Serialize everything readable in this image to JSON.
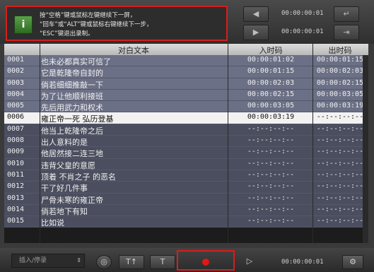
{
  "hint": {
    "icon_text": "i",
    "lines": [
      "按“空格”键或鼠标左键继续下一屏，",
      "“回车”或“ALT”键或鼠标右键继续下一步，",
      "“ESC”键退出录制。"
    ]
  },
  "top_controls": {
    "time_upper": "00:00:00:01",
    "time_lower": "00:00:00:01",
    "prev_icon": "step-back-icon",
    "next_icon": "step-forward-icon",
    "enter_icon": "enter-icon",
    "exit_icon": "exit-icon"
  },
  "table": {
    "headers": {
      "text": "对白文本",
      "in": "入时码",
      "out": "出时码"
    },
    "rows": [
      {
        "idx": "0001",
        "text": "也未必都真实可信了",
        "in": "00:00:01:02",
        "out": "00:00:01:15",
        "state": "done"
      },
      {
        "idx": "0002",
        "text": "它是乾隆帝自封的",
        "in": "00:00:01:15",
        "out": "00:00:02:03",
        "state": "done"
      },
      {
        "idx": "0003",
        "text": "倘若细细推敲一下",
        "in": "00:00:02:03",
        "out": "00:00:02:15",
        "state": "done"
      },
      {
        "idx": "0004",
        "text": "为了让他顺利接班",
        "in": "00:00:02:15",
        "out": "00:00:03:05",
        "state": "done"
      },
      {
        "idx": "0005",
        "text": "先后用武力和权术",
        "in": "00:00:03:05",
        "out": "00:00:03:19",
        "state": "done"
      },
      {
        "idx": "0006",
        "text": "雍正帝一死  弘历登基",
        "in": "00:00:03:19",
        "out": "--:--:--:--",
        "state": "active"
      },
      {
        "idx": "0007",
        "text": "他当上乾隆帝之后",
        "in": "--:--:--:--",
        "out": "--:--:--:--",
        "state": "pending"
      },
      {
        "idx": "0008",
        "text": "出人意料的是",
        "in": "--:--:--:--",
        "out": "--:--:--:--",
        "state": "pending"
      },
      {
        "idx": "0009",
        "text": "他居然接二连三地",
        "in": "--:--:--:--",
        "out": "--:--:--:--",
        "state": "pending"
      },
      {
        "idx": "0010",
        "text": "违背父皇的意愿",
        "in": "--:--:--:--",
        "out": "--:--:--:--",
        "state": "pending"
      },
      {
        "idx": "0011",
        "text": "顶着  不肖之子  的恶名",
        "in": "--:--:--:--",
        "out": "--:--:--:--",
        "state": "pending"
      },
      {
        "idx": "0012",
        "text": "干了好几件事",
        "in": "--:--:--:--",
        "out": "--:--:--:--",
        "state": "pending"
      },
      {
        "idx": "0013",
        "text": "尸骨未寒的雍正帝",
        "in": "--:--:--:--",
        "out": "--:--:--:--",
        "state": "pending"
      },
      {
        "idx": "0014",
        "text": "倘若地下有知",
        "in": "--:--:--:--",
        "out": "--:--:--:--",
        "state": "pending"
      },
      {
        "idx": "0015",
        "text": "比如说",
        "in": "--:--:--:--",
        "out": "--:--:--:--",
        "state": "pending"
      }
    ]
  },
  "bottom": {
    "dropdown_value": "插入/停录",
    "btn_globe_icon": "globe-icon",
    "btn_t1_label": "T↑",
    "btn_t2_label": "T",
    "play_icon": "play-icon",
    "time": "00:00:00:01",
    "settings_icon": "settings-icon"
  }
}
